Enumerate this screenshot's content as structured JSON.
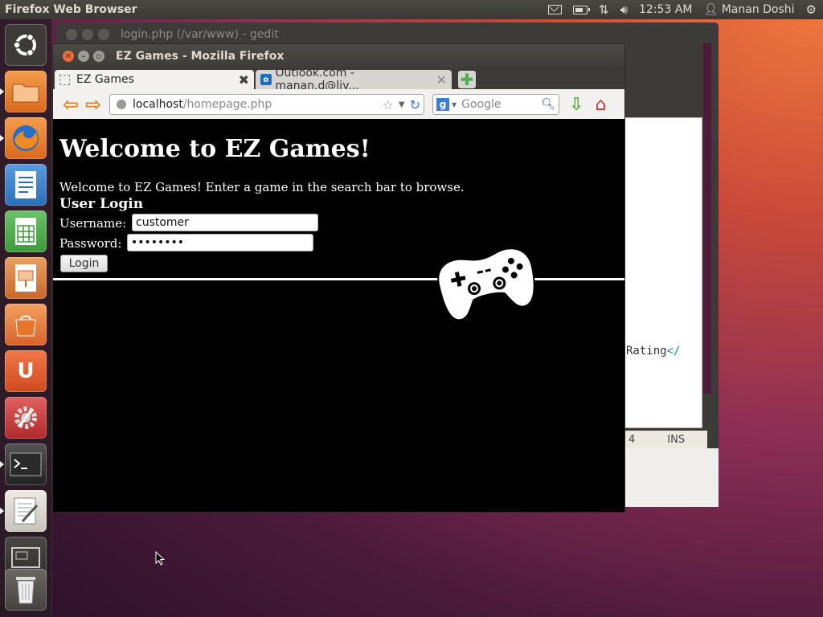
{
  "top_panel": {
    "app_title": "Firefox Web Browser",
    "clock": "12:53 AM",
    "user": "Manan Doshi",
    "icons": [
      "mail-icon",
      "battery-icon",
      "network-icon",
      "volume-icon",
      "gear-icon"
    ]
  },
  "launcher": {
    "items": [
      {
        "name": "dash-home",
        "color": "#3c3b37"
      },
      {
        "name": "files",
        "color": "#e8882c"
      },
      {
        "name": "firefox",
        "color": "#e8882c"
      },
      {
        "name": "libreoffice-writer",
        "color": "#2a6eb8"
      },
      {
        "name": "libreoffice-calc",
        "color": "#3d9b3a"
      },
      {
        "name": "libreoffice-impress",
        "color": "#d07a2e"
      },
      {
        "name": "ubuntu-software-center",
        "color": "#e0742a"
      },
      {
        "name": "ubuntu-one",
        "color": "#e0642a",
        "glyph": "U"
      },
      {
        "name": "system-settings",
        "color": "#c93c3c"
      },
      {
        "name": "terminal",
        "color": "#2d2d2d"
      },
      {
        "name": "gedit",
        "color": "#d0cdc6"
      },
      {
        "name": "workspace-switcher",
        "color": "#3a3935"
      },
      {
        "name": "trash",
        "color": "#5a5853"
      }
    ]
  },
  "gedit": {
    "title": "login.php (/var/www) - gedit",
    "code_text": "Rating",
    "code_tag": "</",
    "status_line": "4",
    "status_mode": "INS"
  },
  "firefox": {
    "window_title": "EZ Games - Mozilla Firefox",
    "tabs": [
      {
        "label": "EZ Games",
        "active": true
      },
      {
        "label": "Outlook.com - manan.d@liv...",
        "active": false
      }
    ],
    "new_tab_glyph": "✚",
    "url_host": "localhost",
    "url_path": "/homepage.php",
    "search_placeholder": "Google",
    "search_engine_glyph": "g"
  },
  "page": {
    "heading": "Welcome to EZ Games!",
    "intro": "Welcome to EZ Games! Enter a game in the search bar to browse.",
    "login_title": "User Login",
    "username_label": "Username:",
    "username_value": "customer",
    "password_label": "Password:",
    "password_value": "••••••••",
    "login_button": "Login"
  },
  "colors": {
    "page_background": "#000000",
    "page_text": "#ffffff",
    "accent_orange": "#ef6c3c"
  }
}
